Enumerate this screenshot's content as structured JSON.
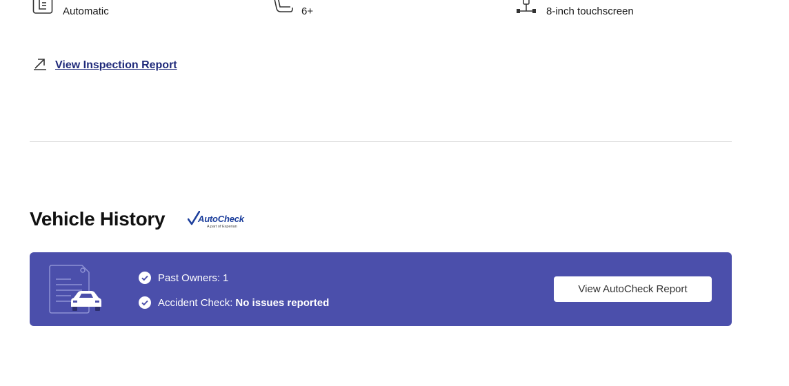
{
  "specs": [
    {
      "icon": "transmission-icon",
      "label": "Automatic"
    },
    {
      "icon": "seat-icon",
      "label": "6+"
    },
    {
      "icon": "touchscreen-icon",
      "label": "8-inch touchscreen"
    }
  ],
  "inspection": {
    "icon": "arrow-up-right-icon",
    "label": "View Inspection Report"
  },
  "history": {
    "title": "Vehicle History",
    "logo": {
      "name": "AutoCheck",
      "tagline": "A part of Experian"
    },
    "banner": {
      "items": [
        {
          "label": "Past Owners:",
          "value": "1"
        },
        {
          "label": "Accident Check:",
          "value": "No issues reported"
        }
      ],
      "button_label": "View AutoCheck Report"
    }
  },
  "colors": {
    "banner_bg": "#4b4fab",
    "link": "#1f2a7a",
    "logo_blue": "#1d3f9c"
  }
}
